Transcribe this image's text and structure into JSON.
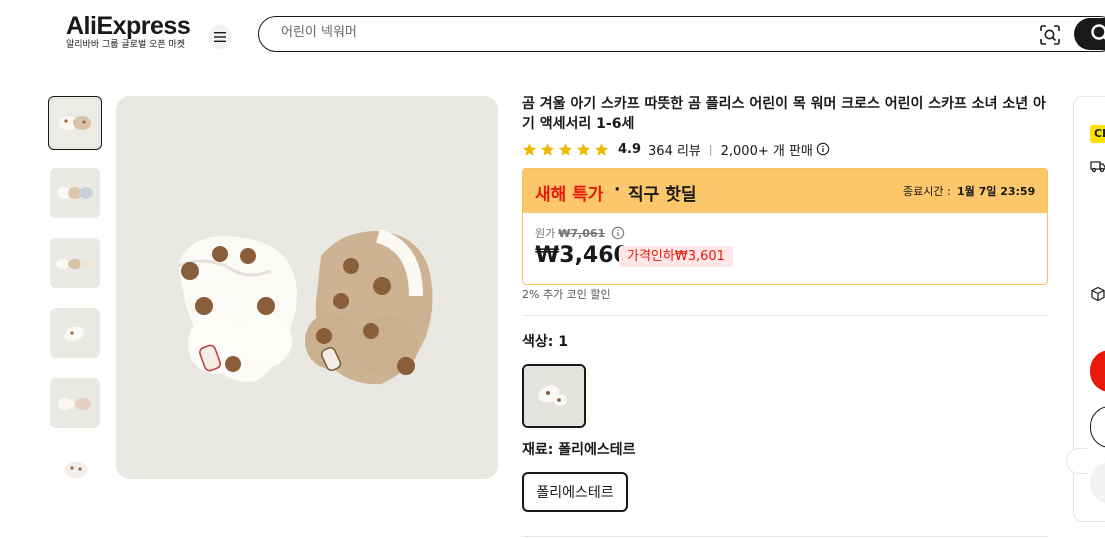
{
  "header": {
    "logo_text": "AliExpress",
    "logo_tagline": "알리바바 그룹 글로벌 오픈 마켓",
    "menu_icon": "hamburger-menu-icon",
    "search_placeholder": "어린이 넥워머",
    "scan_icon": "image-search-icon",
    "search_icon": "search-icon"
  },
  "gallery": {
    "thumbnails": [
      {
        "name": "thumbnail-1",
        "active": true
      },
      {
        "name": "thumbnail-2",
        "active": false
      },
      {
        "name": "thumbnail-3",
        "active": false
      },
      {
        "name": "thumbnail-4",
        "active": false
      },
      {
        "name": "thumbnail-5",
        "active": false
      },
      {
        "name": "thumbnail-6",
        "active": false
      }
    ]
  },
  "product": {
    "title": "곰 겨울 아기 스카프 따뜻한 곰 플리스 어린이 목 워머 크로스 어린이 스카프 소녀 소년 아기 액세서리 1-6세",
    "rating": "4.9",
    "reviews": "364 리뷰",
    "separator": "|",
    "sold": "2,000+ 개 판매",
    "star_color": "#f0b800"
  },
  "deal": {
    "name": "새해 특가",
    "dot": "·",
    "subtitle": "직구 핫딜",
    "end_label": "종료시간 :",
    "end_time": "1월 7일 23:59",
    "original_label": "원가",
    "original_price": "₩7,061",
    "price": "₩3,460",
    "discount": "가격인하₩3,601",
    "header_color": "#fcc76b",
    "accent_color": "#e8190b"
  },
  "coin_text": "2% 추가 코인 할인",
  "options": {
    "color_label": "색상: 1",
    "material_label": "재료: 폴리에스테르",
    "material_value": "폴리에스테르"
  },
  "side_panel": {
    "badge": "Ch",
    "truck_icon": "truck-icon",
    "box_icon": "package-icon"
  }
}
